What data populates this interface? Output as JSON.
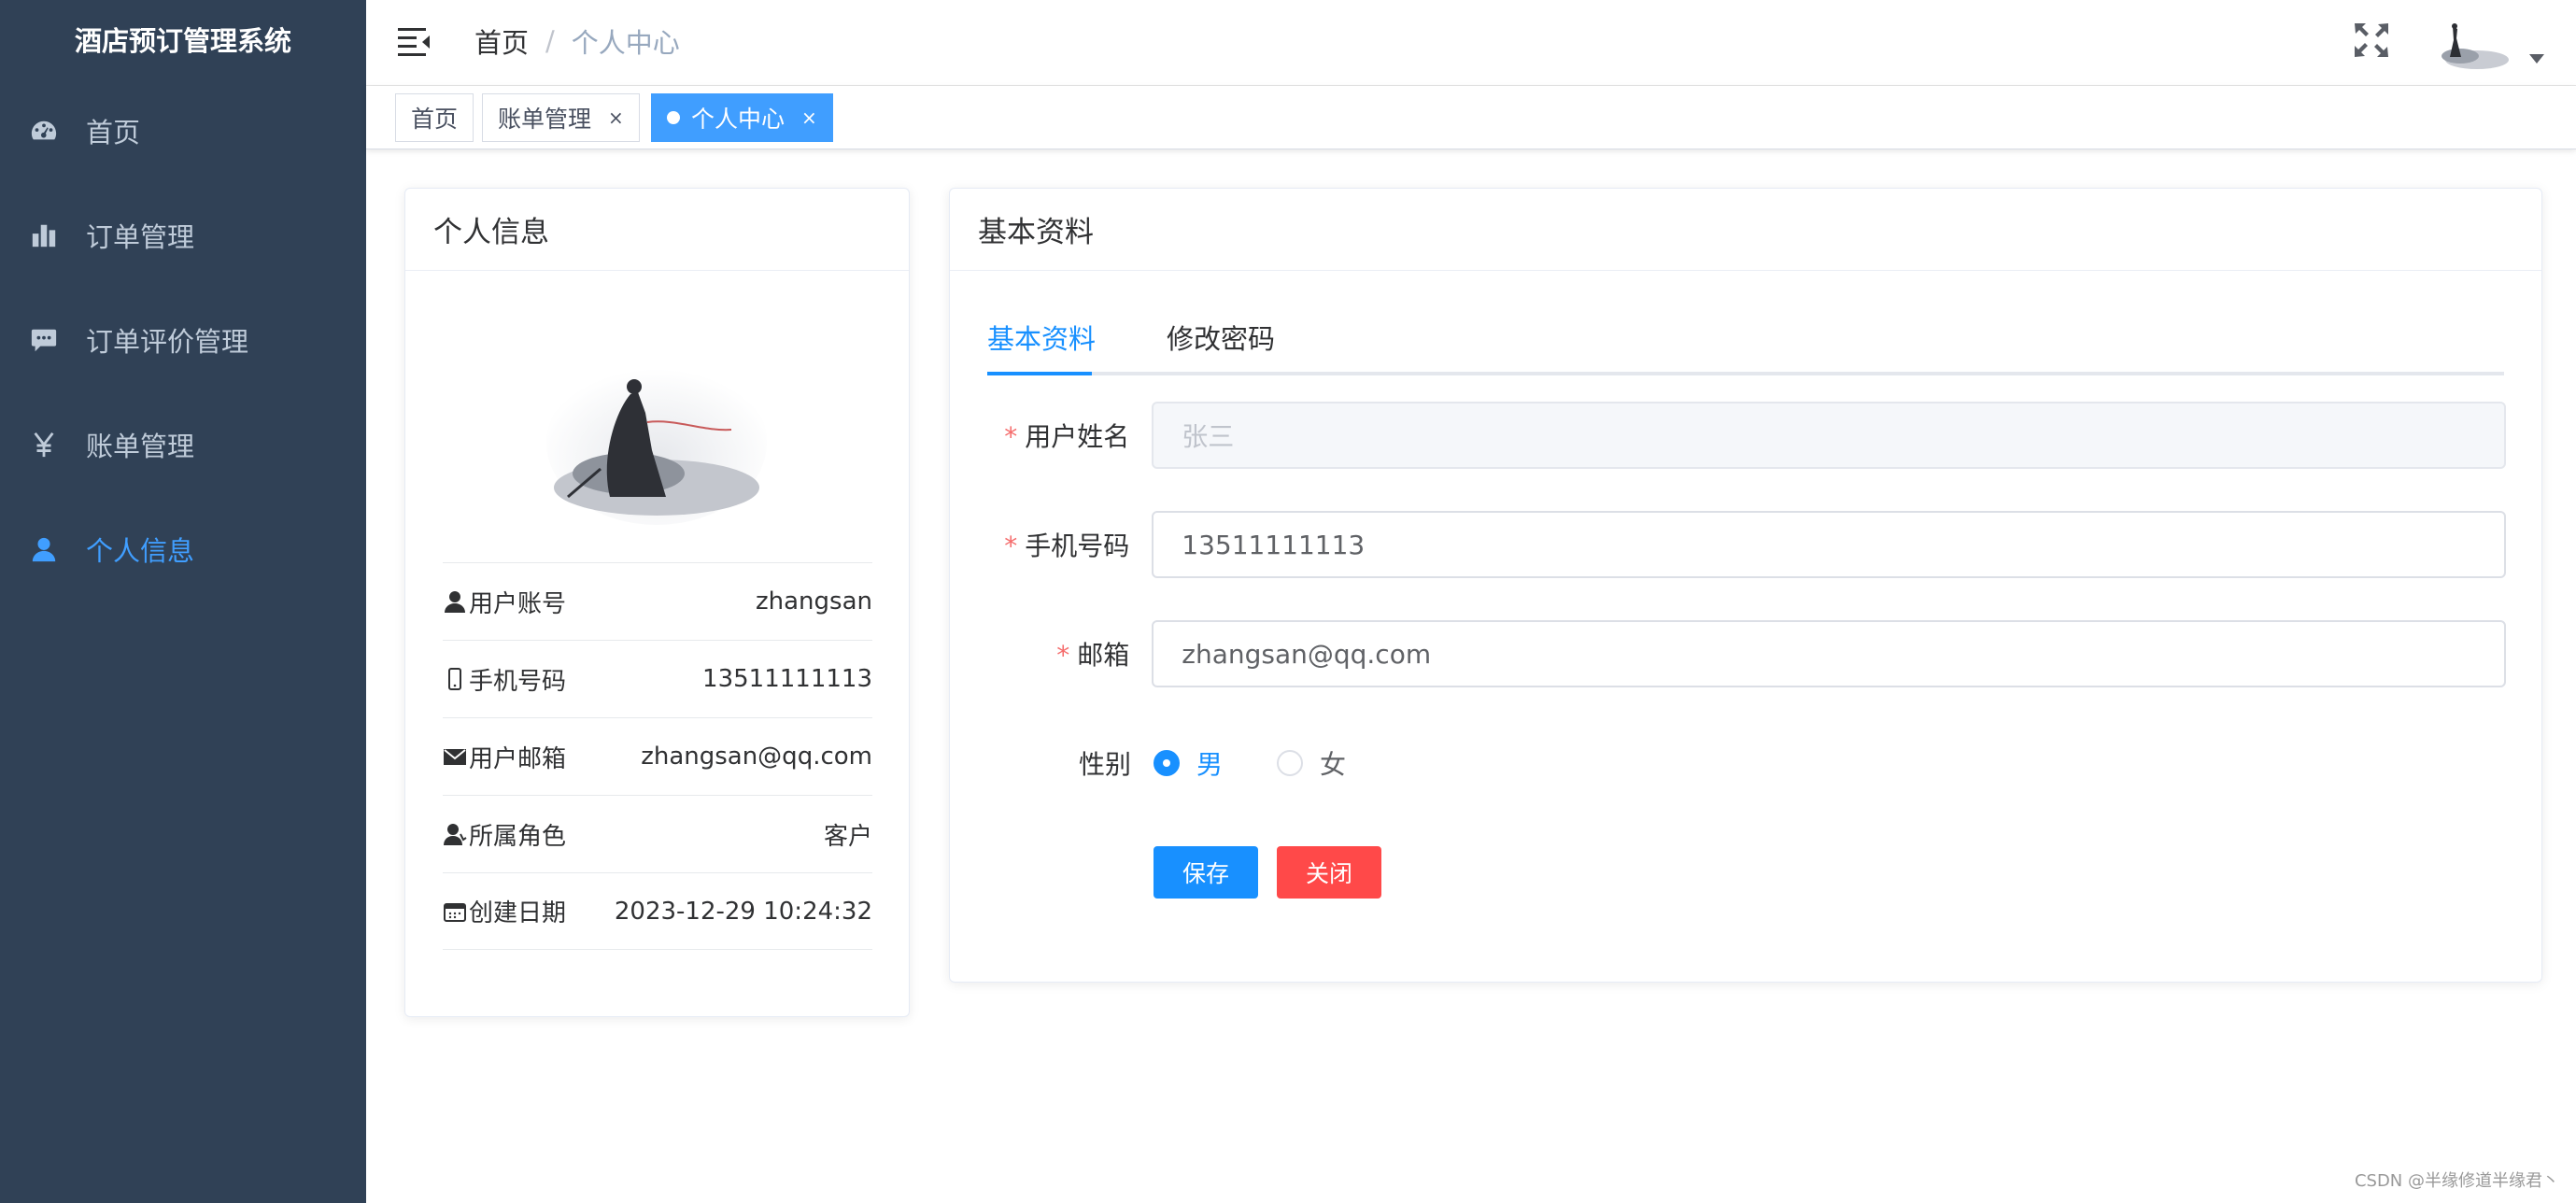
{
  "app": {
    "title": "酒店预订管理系统"
  },
  "sidebar": {
    "items": [
      {
        "label": "首页",
        "icon": "dashboard-icon"
      },
      {
        "label": "订单管理",
        "icon": "bar-chart-icon"
      },
      {
        "label": "订单评价管理",
        "icon": "comment-icon"
      },
      {
        "label": "账单管理",
        "icon": "yen-icon"
      },
      {
        "label": "个人信息",
        "icon": "user-icon",
        "active": true
      }
    ]
  },
  "navbar": {
    "breadcrumb": {
      "home": "首页",
      "separator": "/",
      "current": "个人中心"
    }
  },
  "tags": {
    "items": [
      {
        "label": "首页"
      },
      {
        "label": "账单管理",
        "close": "×"
      },
      {
        "label": "个人中心",
        "close": "×",
        "active": true
      }
    ]
  },
  "profile": {
    "title": "个人信息",
    "rows": [
      {
        "label": "用户账号",
        "value": "zhangsan",
        "icon": "user-icon"
      },
      {
        "label": "手机号码",
        "value": "13511111113",
        "icon": "phone-icon"
      },
      {
        "label": "用户邮箱",
        "value": "zhangsan@qq.com",
        "icon": "mail-icon"
      },
      {
        "label": "所属角色",
        "value": "客户",
        "icon": "role-icon"
      },
      {
        "label": "创建日期",
        "value": "2023-12-29 10:24:32",
        "icon": "calendar-icon"
      }
    ]
  },
  "basic": {
    "title": "基本资料",
    "tabs": [
      {
        "label": "基本资料",
        "active": true
      },
      {
        "label": "修改密码"
      }
    ],
    "form": {
      "username": {
        "required": "*",
        "label": "用户姓名",
        "value": "张三"
      },
      "phone": {
        "required": "*",
        "label": "手机号码",
        "value": "13511111113"
      },
      "email": {
        "required": "*",
        "label": "邮箱",
        "value": "zhangsan@qq.com"
      },
      "gender": {
        "label": "性别",
        "options": [
          "男",
          "女"
        ],
        "selected": "男"
      }
    },
    "buttons": {
      "save": "保存",
      "close": "关闭"
    }
  },
  "footer": {
    "watermark": "CSDN @半缘修道半缘君丶"
  },
  "colors": {
    "sidebar_bg": "#304156",
    "accent": "#1890ff",
    "danger": "#ff4949"
  }
}
